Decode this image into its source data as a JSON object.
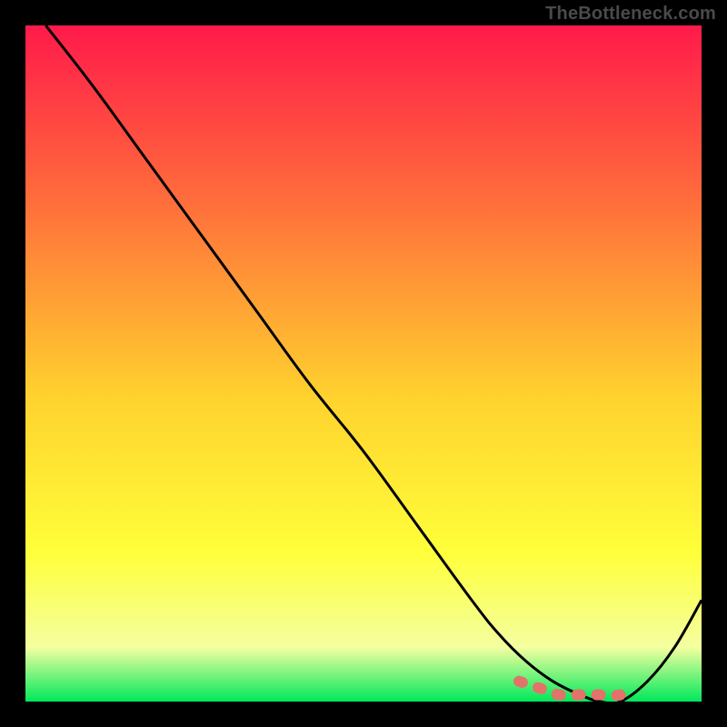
{
  "watermark": "TheBottleneck.com",
  "colors": {
    "frame": "#000000",
    "gradient_top": "#ff1a4a",
    "gradient_mid1": "#ff6a3c",
    "gradient_mid2": "#ffd22e",
    "gradient_mid3": "#ffff3a",
    "gradient_mid4": "#f4ffa0",
    "gradient_bottom": "#00e85b",
    "curve": "#000000",
    "highlight": "#e2726a"
  },
  "chart_data": {
    "type": "line",
    "title": "",
    "xlabel": "",
    "ylabel": "",
    "xlim": [
      0,
      100
    ],
    "ylim": [
      0,
      100
    ],
    "grid": false,
    "legend": false,
    "annotations": [],
    "series": [
      {
        "name": "curve",
        "x": [
          3,
          10,
          18,
          26,
          34,
          42,
          50,
          58,
          66,
          70,
          74,
          78,
          82,
          85,
          88,
          92,
          96,
          100
        ],
        "values": [
          100,
          91,
          80,
          69,
          58,
          47,
          37,
          26,
          15,
          10,
          6,
          3,
          1,
          0,
          0,
          3,
          8,
          15
        ]
      },
      {
        "name": "highlight-band",
        "x": [
          73,
          76,
          79,
          82,
          85,
          88,
          90
        ],
        "values": [
          3,
          2,
          1,
          1,
          1,
          1,
          2
        ]
      }
    ]
  }
}
